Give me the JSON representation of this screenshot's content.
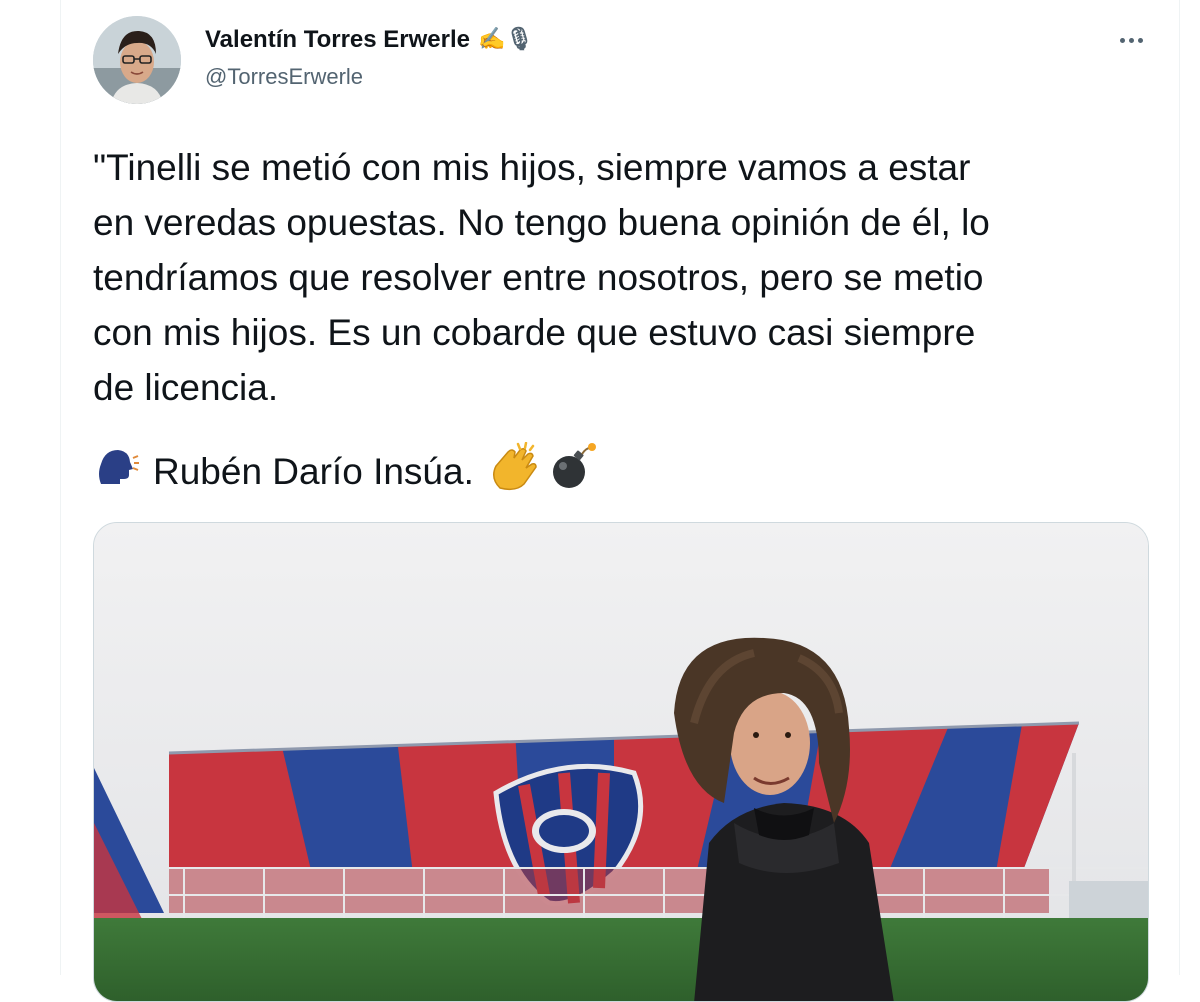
{
  "tweet": {
    "author_name": "Valentín Torres Erwerle",
    "name_emojis": "✍️🎙",
    "handle": "@TorresErwerle",
    "text": "\"Tinelli se metió con mis hijos, siempre vamos a estar\nen veredas opuestas. No tengo buena opinión de él, lo\ntendríamos que resolver entre nosotros, pero se metio\ncon mis hijos. Es un cobarde que estuvo casi siempre\nde licencia.",
    "signature_name": "Rubén Darío Insúa."
  },
  "icons": {
    "avatar": "profile-photo",
    "more": "more-options-icon",
    "speaking_head": "speaking-head-icon",
    "clapping": "clapping-hands-icon",
    "bomb": "bomb-icon"
  },
  "colors": {
    "text_primary": "#0f1419",
    "text_secondary": "#536471",
    "border": "#cfd9de",
    "stadium_red": "#c8353f",
    "stadium_blue": "#2b4a9a"
  }
}
